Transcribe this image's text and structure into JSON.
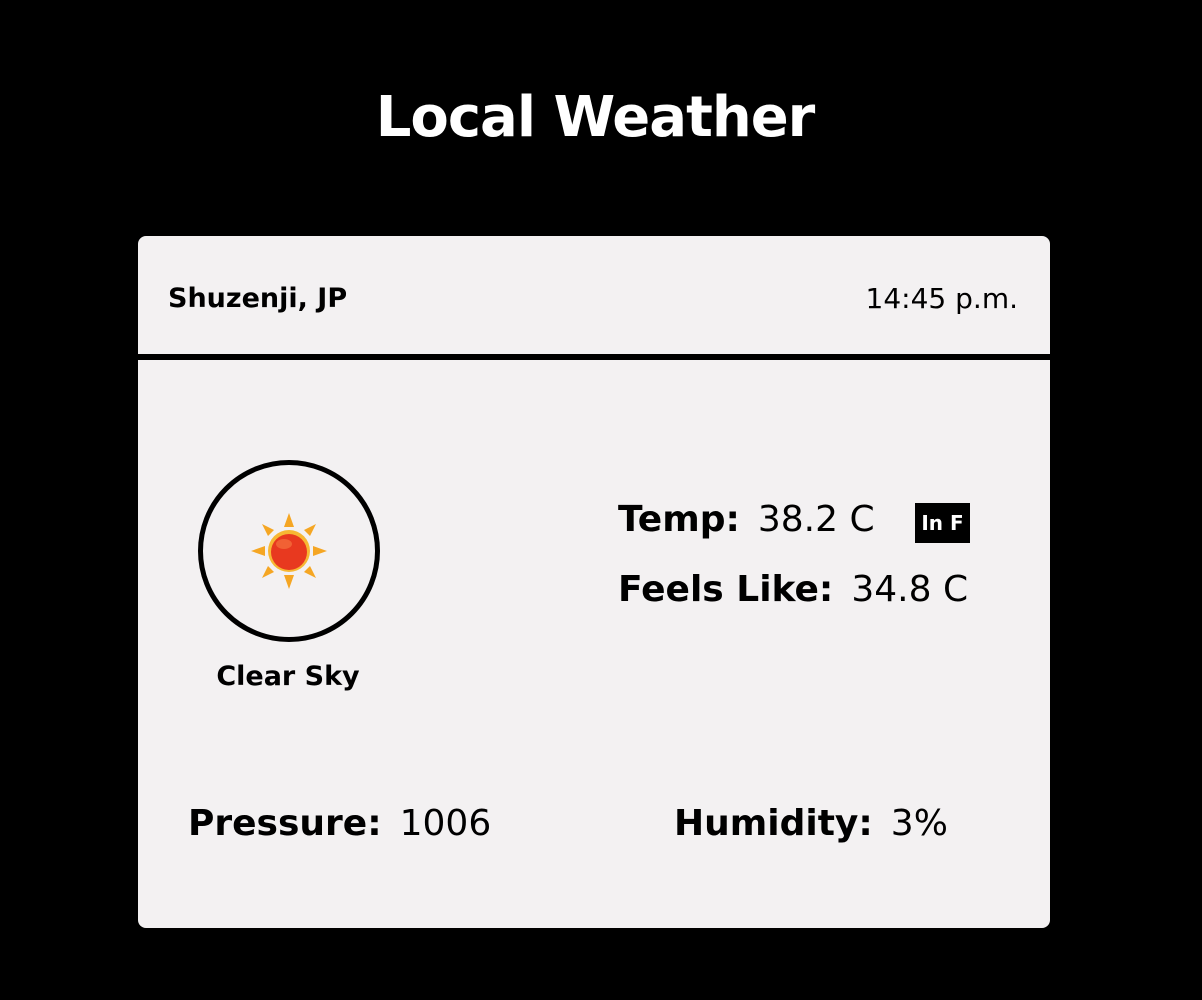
{
  "header": {
    "title": "Local Weather"
  },
  "card": {
    "location": "Shuzenji, JP",
    "time": "14:45 p.m.",
    "weather_icon": "sun-icon",
    "condition": "Clear Sky",
    "temp": {
      "label": "Temp:",
      "value": "38.2 C"
    },
    "unit_toggle_label": "In F",
    "feels_like": {
      "label": "Feels Like:",
      "value": "34.8 C"
    },
    "pressure": {
      "label": "Pressure:",
      "value": "1006"
    },
    "humidity": {
      "label": "Humidity:",
      "value": "3%"
    }
  },
  "colors": {
    "background": "#000000",
    "card": "#f3f1f2",
    "sun_core": "#e8391f",
    "sun_rays": "#f5a623"
  }
}
